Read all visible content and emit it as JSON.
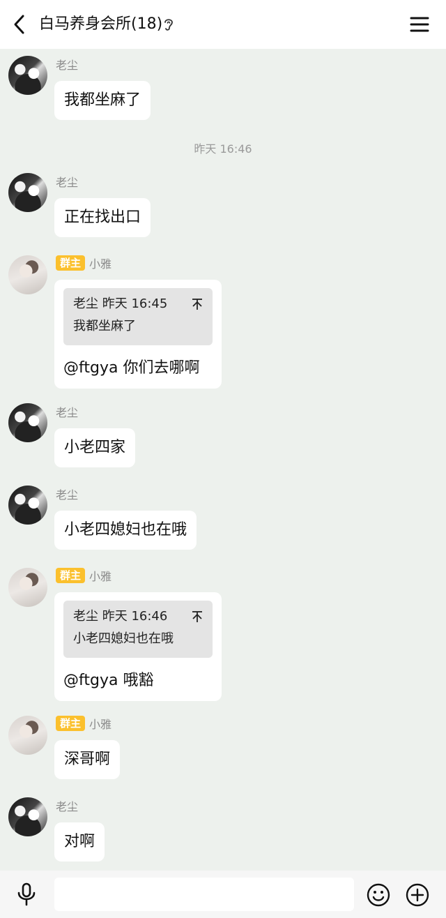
{
  "header": {
    "title": "白马养身会所(18)",
    "back_icon": "chevron-left-icon",
    "ear_icon": "ear-icon",
    "menu_icon": "menu-icon"
  },
  "messages": [
    {
      "sender": "老尘",
      "text": "我都坐麻了"
    },
    {
      "timestamp": "昨天 16:46"
    },
    {
      "sender": "老尘",
      "text": "正在找出口"
    },
    {
      "sender": "小雅",
      "badge": "群主",
      "quote": {
        "author": "老尘",
        "time": "昨天 16:45",
        "text": "我都坐麻了"
      },
      "text": "@ftgya 你们去哪啊"
    },
    {
      "sender": "老尘",
      "text": "小老四家"
    },
    {
      "sender": "老尘",
      "text": "小老四媳妇也在哦"
    },
    {
      "sender": "小雅",
      "badge": "群主",
      "quote": {
        "author": "老尘",
        "time": "昨天 16:46",
        "text": "小老四媳妇也在哦"
      },
      "text": "@ftgya 哦豁"
    },
    {
      "sender": "小雅",
      "badge": "群主",
      "text": "深哥啊"
    },
    {
      "sender": "老尘",
      "text": "对啊"
    }
  ],
  "input": {
    "value": "",
    "placeholder": ""
  },
  "icons": {
    "mic": "mic-icon",
    "emoji": "emoji-icon",
    "plus": "plus-icon",
    "quote_arrow": "arrow-up-icon"
  },
  "colors": {
    "badge": "#fbc02d",
    "background": "#edf1ed",
    "bubble": "#ffffff"
  }
}
